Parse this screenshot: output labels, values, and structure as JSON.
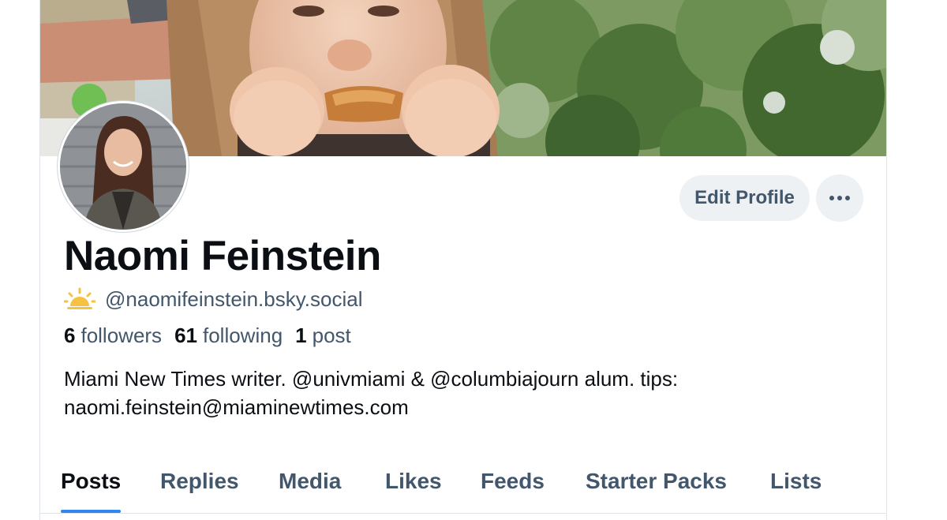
{
  "profile": {
    "display_name": "Naomi Feinstein",
    "handle": "@naomifeinstein.bsky.social",
    "verify_icon": "sun-icon",
    "bio": "Miami New Times writer. @univmiami & @columbiajourn alum. tips: naomi.feinstein@miaminewtimes.com"
  },
  "stats": {
    "followers_count": "6",
    "followers_label": "followers",
    "following_count": "61",
    "following_label": "following",
    "posts_count": "1",
    "posts_label": "post"
  },
  "actions": {
    "edit_profile_label": "Edit Profile",
    "more_icon": "ellipsis-icon"
  },
  "tabs": [
    {
      "label": "Posts",
      "active": true
    },
    {
      "label": "Replies",
      "active": false
    },
    {
      "label": "Media",
      "active": false
    },
    {
      "label": "Likes",
      "active": false
    },
    {
      "label": "Feeds",
      "active": false
    },
    {
      "label": "Starter Packs",
      "active": false
    },
    {
      "label": "Lists",
      "active": false
    }
  ],
  "colors": {
    "accent": "#2f87ec",
    "text_primary": "#0b0f14",
    "text_secondary": "#42566c",
    "button_bg": "#eef1f4",
    "sun_icon": "#f5c242"
  }
}
